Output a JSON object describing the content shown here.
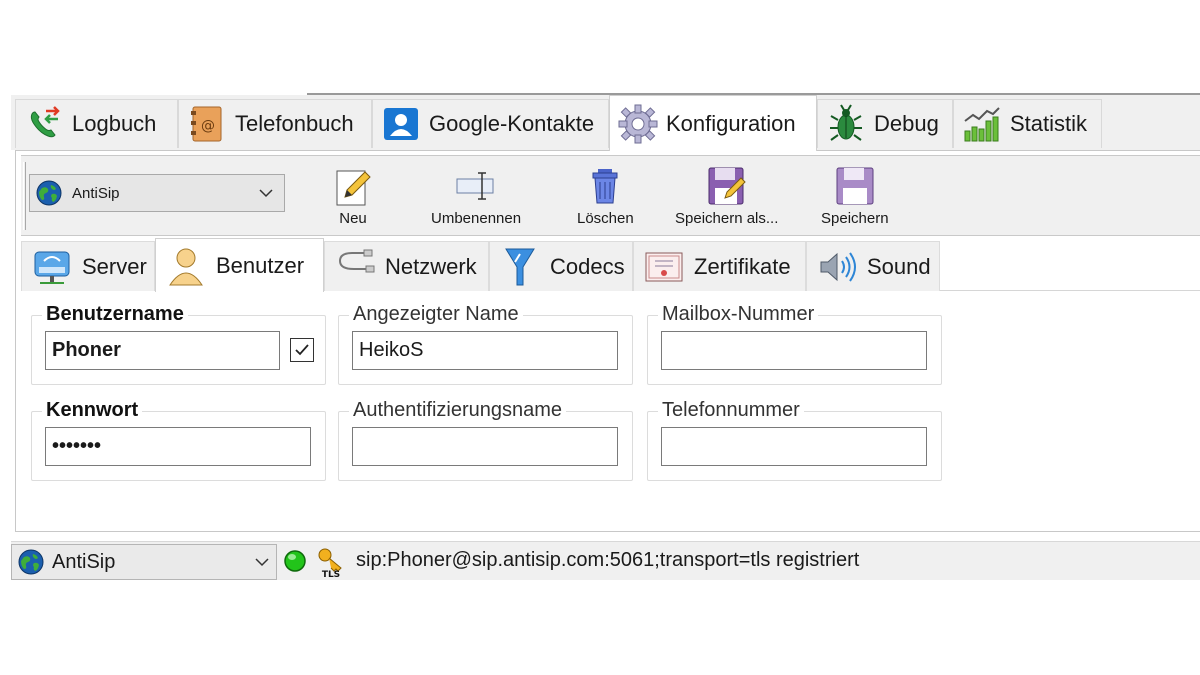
{
  "main_tabs": [
    {
      "label": "Logbuch",
      "icon": "phone-log-icon"
    },
    {
      "label": "Telefonbuch",
      "icon": "address-book-icon"
    },
    {
      "label": "Google-Kontakte",
      "icon": "contacts-icon"
    },
    {
      "label": "Konfiguration",
      "icon": "gear-icon",
      "active": true
    },
    {
      "label": "Debug",
      "icon": "bug-icon"
    },
    {
      "label": "Statistik",
      "icon": "statistics-icon"
    }
  ],
  "toolbar": {
    "account_value": "AntiSip",
    "buttons": [
      {
        "label": "Neu",
        "icon": "new-edit-icon"
      },
      {
        "label": "Umbenennen",
        "icon": "rename-icon"
      },
      {
        "label": "Löschen",
        "icon": "trash-icon"
      },
      {
        "label": "Speichern als...",
        "icon": "save-as-icon"
      },
      {
        "label": "Speichern",
        "icon": "save-icon"
      }
    ]
  },
  "sub_tabs": [
    {
      "label": "Server",
      "icon": "server-icon"
    },
    {
      "label": "Benutzer",
      "icon": "user-icon",
      "active": true
    },
    {
      "label": "Netzwerk",
      "icon": "network-icon"
    },
    {
      "label": "Codecs",
      "icon": "codecs-icon"
    },
    {
      "label": "Zertifikate",
      "icon": "certificate-icon"
    },
    {
      "label": "Sound",
      "icon": "speaker-icon"
    }
  ],
  "form": {
    "username": {
      "label": "Benutzername",
      "value": "Phoner",
      "checked": true
    },
    "display_name": {
      "label": "Angezeigter Name",
      "value": "HeikoS"
    },
    "mailbox": {
      "label": "Mailbox-Nummer",
      "value": ""
    },
    "password": {
      "label": "Kennwort",
      "value": "•••••••"
    },
    "auth_name": {
      "label": "Authentifizierungsname",
      "value": ""
    },
    "phone_number": {
      "label": "Telefonnummer",
      "value": ""
    }
  },
  "status_bar": {
    "account_value": "AntiSip",
    "registration_text": "sip:Phoner@sip.antisip.com:5061;transport=tls registriert",
    "status_color": "#22c41a",
    "tls_badge": "TLS"
  }
}
